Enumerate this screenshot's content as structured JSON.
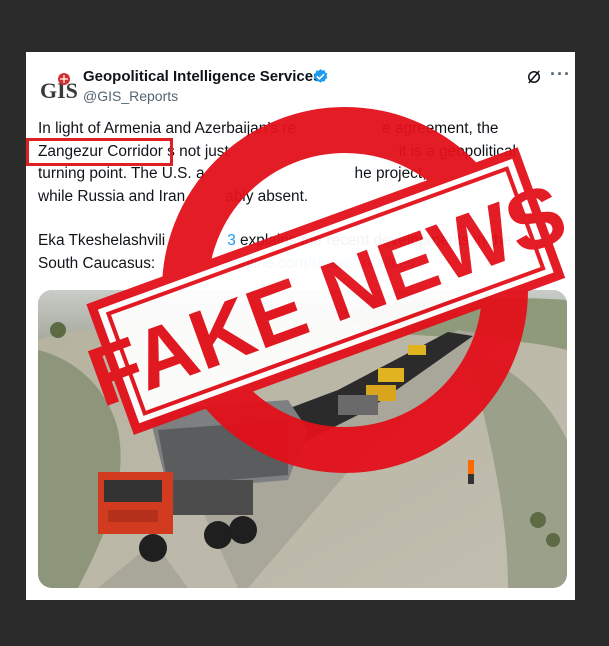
{
  "post": {
    "author_name": "Geopolitical Intelligence Services",
    "handle": "@GIS_Reports",
    "logo_text": "GIS",
    "paragraph1_a": "In light of Armenia and Azerbaijan’s re",
    "paragraph1_b": "e agreement, the",
    "highlight": "Zangezur Corridor",
    "paragraph1_c": "s not just",
    "paragraph1_d": "it is a geopolitical",
    "paragraph1_e": "turning point. The U.S. a",
    "paragraph1_f": "he project,",
    "paragraph1_g": "while Russia and Iran",
    "paragraph1_h": "ably absent.",
    "paragraph2_a": "Eka Tkeshelashvili",
    "paragraph2_mention": "3",
    "paragraph2_b": "explains the recent developments in the",
    "paragraph2_c": "South Caucasus:",
    "paragraph2_link": "sonline.com/r/news-realities"
  },
  "stamp": {
    "text": "FAKE NEWS",
    "color": "#e3101a"
  },
  "icons": {
    "verified": "verified-badge-icon",
    "grok": "grok-icon",
    "more": "more-options-icon"
  }
}
